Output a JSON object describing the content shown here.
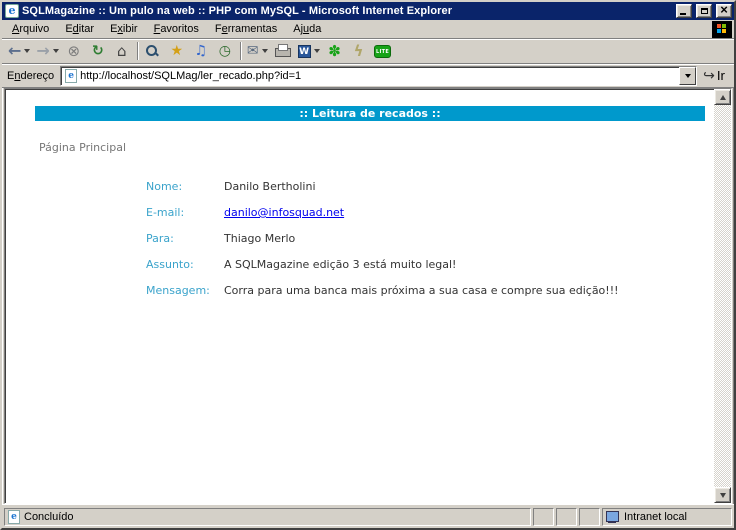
{
  "colors": {
    "titlebar": "#0A246A",
    "page_header_bg": "#0099CC",
    "field_label": "#3AA3CB",
    "link": "#0000EE"
  },
  "window": {
    "title": "SQLMagazine :: Um pulo na web :: PHP com MySQL - Microsoft Internet Explorer"
  },
  "menu_bar": {
    "items": [
      {
        "id": "arquivo",
        "label": "Arquivo",
        "u_index": 0
      },
      {
        "id": "editar",
        "label": "Editar",
        "u_index": 1
      },
      {
        "id": "exibir",
        "label": "Exibir",
        "u_index": 1
      },
      {
        "id": "favoritos",
        "label": "Favoritos",
        "u_index": 0
      },
      {
        "id": "ferramentas",
        "label": "Ferramentas",
        "u_index": 1
      },
      {
        "id": "ajuda",
        "label": "Ajuda",
        "u_index": 2
      }
    ]
  },
  "toolbar": {
    "items": [
      {
        "name": "back-icon",
        "glyph": "←",
        "caret": true
      },
      {
        "name": "forward-icon",
        "glyph": "→",
        "caret": true
      },
      {
        "name": "stop-icon",
        "glyph": "⊗"
      },
      {
        "name": "refresh-icon",
        "glyph": "↻"
      },
      {
        "name": "home-icon",
        "glyph": "⌂"
      },
      {
        "sep": true
      },
      {
        "name": "search-icon",
        "glyph": ""
      },
      {
        "name": "favorites-icon",
        "glyph": "★"
      },
      {
        "name": "media-icon",
        "glyph": "♫"
      },
      {
        "name": "history-icon",
        "glyph": "◷"
      },
      {
        "sep": true
      },
      {
        "name": "mail-icon",
        "glyph": "✉",
        "caret": true
      },
      {
        "name": "print-icon",
        "glyph": ""
      },
      {
        "name": "edit-word-icon",
        "glyph": "W",
        "caret": true
      },
      {
        "name": "icq-flower-icon",
        "glyph": "✽"
      },
      {
        "name": "lightning-icon",
        "glyph": "ϟ"
      },
      {
        "name": "icq-lite-icon",
        "glyph": "LITE"
      }
    ]
  },
  "address_bar": {
    "label": "Endereço",
    "label_u_index": 1,
    "url": "http://localhost/SQLMag/ler_recado.php?id=1",
    "go_label": "Ir"
  },
  "page": {
    "header_title": ":: Leitura de recados ::",
    "home_link": "Página Principal",
    "fields": [
      {
        "label": "Nome:",
        "value": "Danilo Bertholini",
        "is_link": false
      },
      {
        "label": "E-mail:",
        "value": "danilo@infosquad.net",
        "is_link": true
      },
      {
        "label": "Para:",
        "value": "Thiago Merlo",
        "is_link": false
      },
      {
        "label": "Assunto:",
        "value": "A SQLMagazine edição 3 está muito legal!",
        "is_link": false
      },
      {
        "label": "Mensagem:",
        "value": "Corra para uma banca mais próxima a sua casa e compre sua edição!!!",
        "is_link": false
      }
    ]
  },
  "status_bar": {
    "status_text": "Concluído",
    "zone_text": "Intranet local"
  }
}
